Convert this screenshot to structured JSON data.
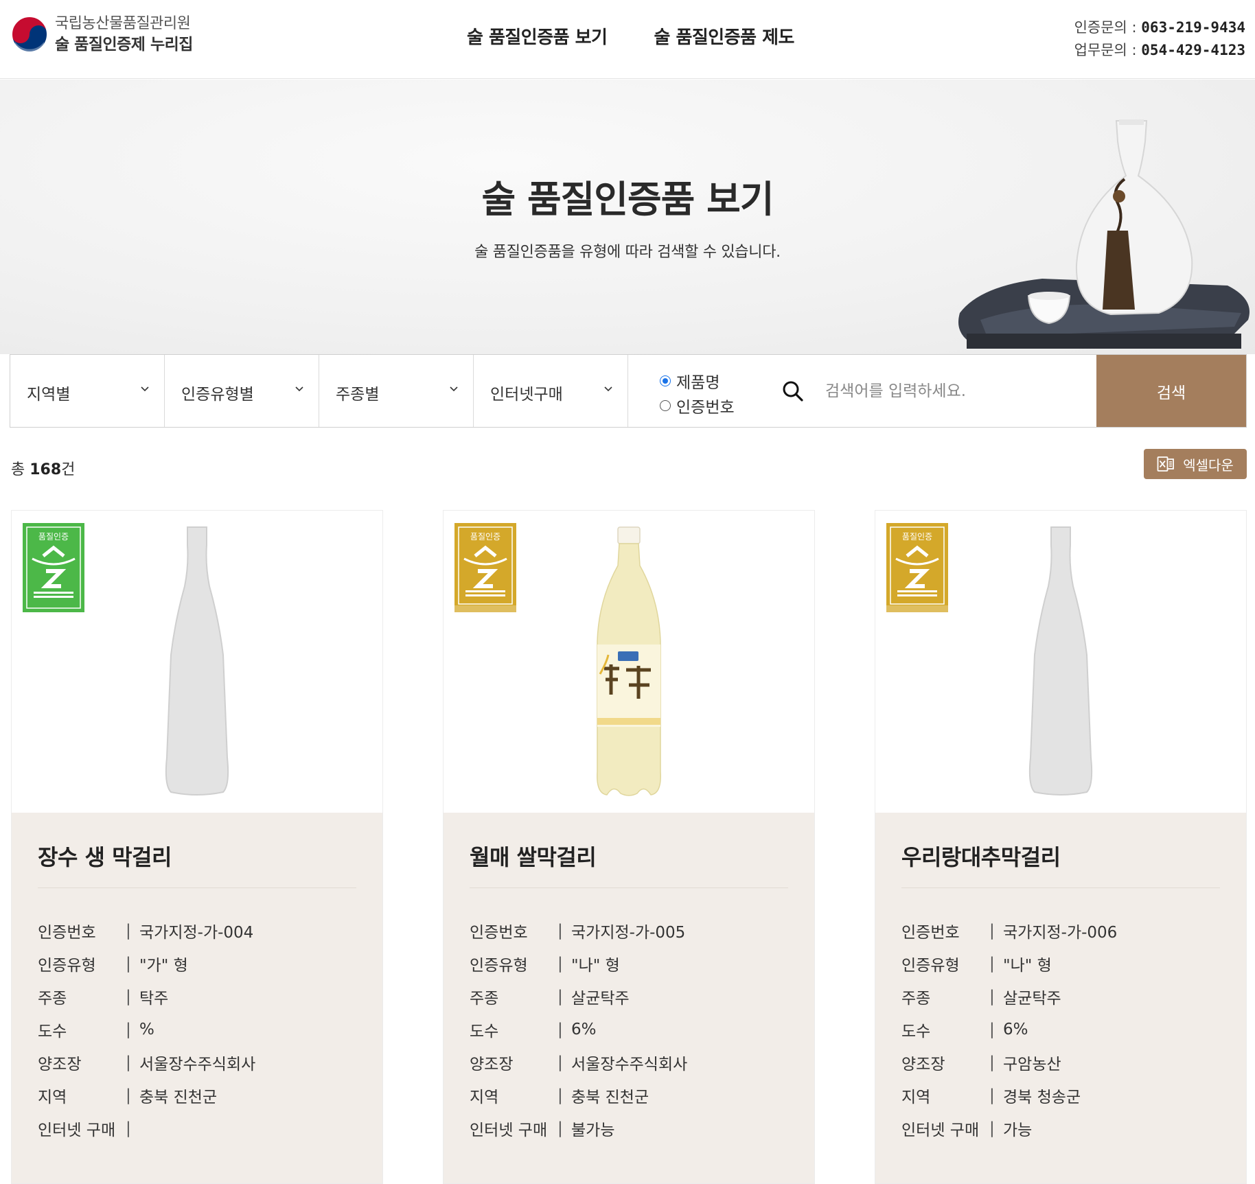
{
  "header": {
    "logo_line1": "국립농산물품질관리원",
    "logo_line2": "술 품질인증제 누리집",
    "nav": [
      "술 품질인증품 보기",
      "술 품질인증품 제도"
    ],
    "contact": [
      {
        "label": "인증문의 : ",
        "value": "063-219-9434"
      },
      {
        "label": "업무문의 : ",
        "value": "054-429-4123"
      }
    ]
  },
  "hero": {
    "title": "술 품질인증품 보기",
    "subtitle": "술 품질인증품을 유형에 따라 검색할 수 있습니다."
  },
  "search": {
    "filters": [
      "지역별",
      "인증유형별",
      "주종별",
      "인터넷구매"
    ],
    "radio_options": [
      "제품명",
      "인증번호"
    ],
    "selected_radio": "제품명",
    "placeholder": "검색어를 입력하세요.",
    "button": "검색"
  },
  "results": {
    "total_prefix": "총 ",
    "total_count": "168",
    "total_suffix": "건",
    "excel_label": "엑셀다운"
  },
  "colors": {
    "accent": "#a47e5d",
    "card_info_bg": "#f2ede8",
    "badge_green": "#4cb848",
    "badge_gold": "#d4a82a"
  },
  "cards": [
    {
      "title": "장수 생 막걸리",
      "badge_color": "green",
      "image": "placeholder-bottle",
      "badge_text": "품질인증",
      "rows": [
        {
          "key": "인증번호",
          "value": "국가지정-가-004"
        },
        {
          "key": "인증유형",
          "value": "\"가\" 형"
        },
        {
          "key": "주종",
          "value": "탁주"
        },
        {
          "key": "도수",
          "value": "%"
        },
        {
          "key": "양조장",
          "value": "서울장수주식회사"
        },
        {
          "key": "지역",
          "value": "충북 진천군"
        },
        {
          "key": "인터넷 구매",
          "value": ""
        }
      ]
    },
    {
      "title": "월매 쌀막걸리",
      "badge_color": "gold",
      "image": "makgeolli-bottle",
      "badge_text": "품질인증",
      "rows": [
        {
          "key": "인증번호",
          "value": "국가지정-가-005"
        },
        {
          "key": "인증유형",
          "value": "\"나\" 형"
        },
        {
          "key": "주종",
          "value": "살균탁주"
        },
        {
          "key": "도수",
          "value": "6%"
        },
        {
          "key": "양조장",
          "value": "서울장수주식회사"
        },
        {
          "key": "지역",
          "value": "충북 진천군"
        },
        {
          "key": "인터넷 구매",
          "value": "불가능"
        }
      ]
    },
    {
      "title": "우리랑대추막걸리",
      "badge_color": "gold",
      "image": "placeholder-bottle",
      "badge_text": "품질인증",
      "rows": [
        {
          "key": "인증번호",
          "value": "국가지정-가-006"
        },
        {
          "key": "인증유형",
          "value": "\"나\" 형"
        },
        {
          "key": "주종",
          "value": "살균탁주"
        },
        {
          "key": "도수",
          "value": "6%"
        },
        {
          "key": "양조장",
          "value": "구암농산"
        },
        {
          "key": "지역",
          "value": "경북 청송군"
        },
        {
          "key": "인터넷 구매",
          "value": "가능"
        }
      ]
    }
  ]
}
